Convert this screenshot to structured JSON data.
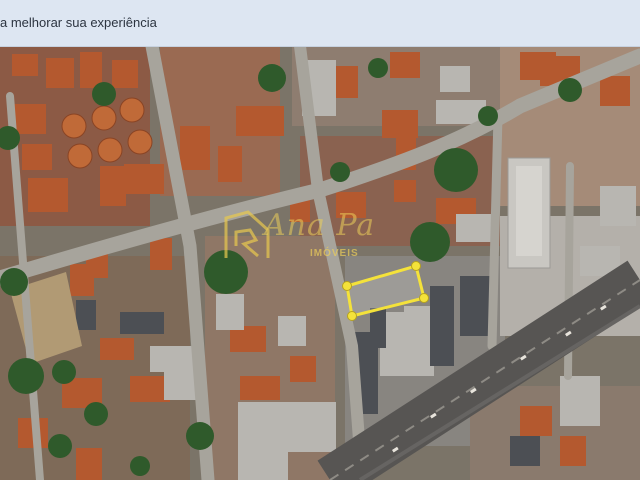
{
  "cookie_banner": {
    "text": "a melhorar sua experiência"
  },
  "map": {
    "type": "satellite",
    "highlight_color": "#f4e23a",
    "watermark_color": "#e9c94f",
    "watermark": {
      "brand_name": "Ana Pa",
      "brand_tagline": "IMÓVEIS"
    }
  }
}
